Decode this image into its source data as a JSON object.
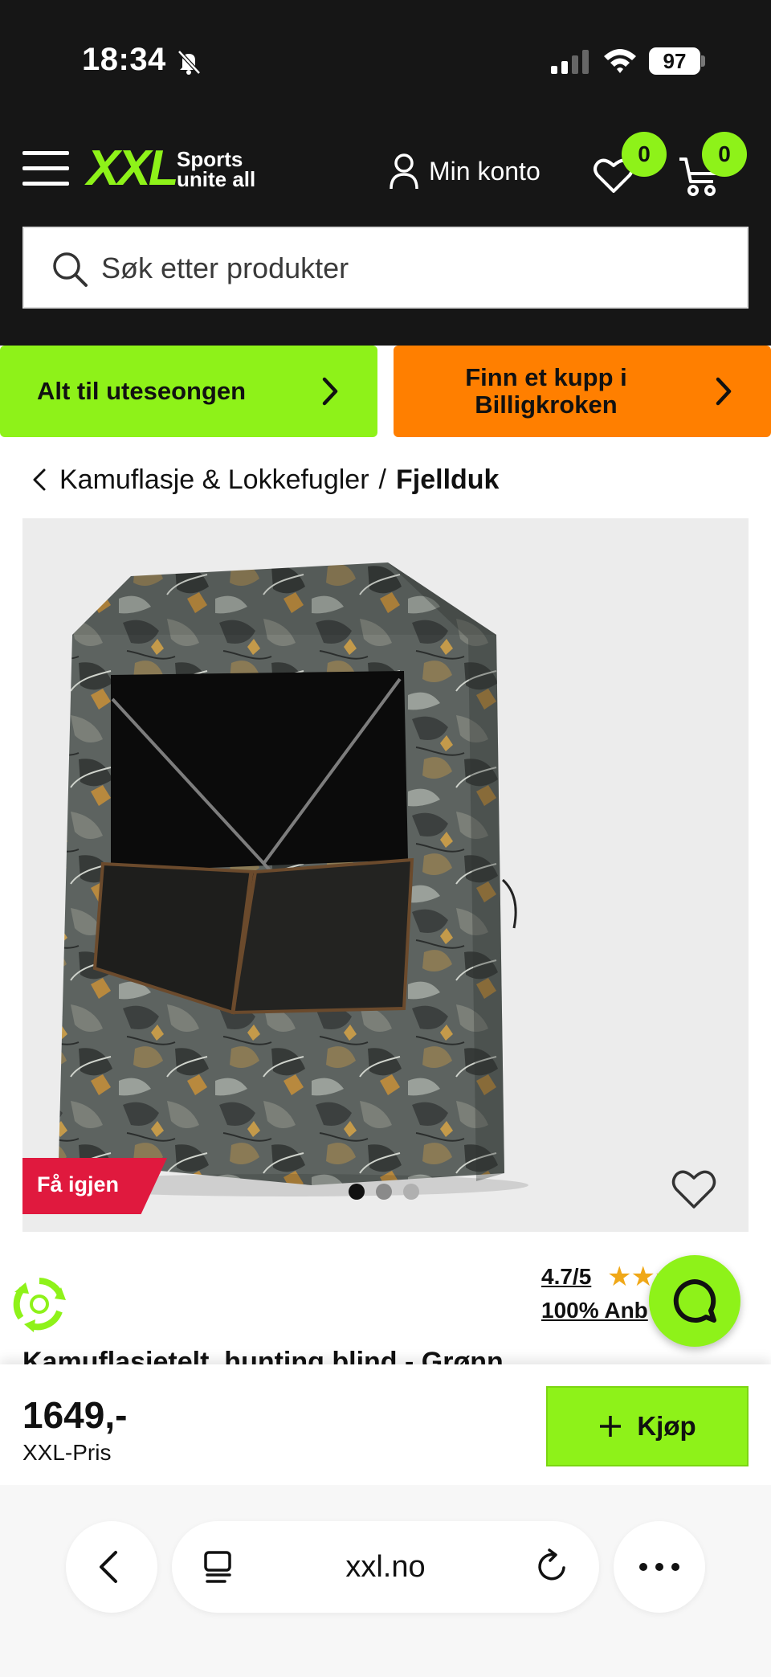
{
  "status_bar": {
    "time": "18:34",
    "battery": "97"
  },
  "header": {
    "logo_text": "XXL",
    "logo_tagline_line1": "Sports",
    "logo_tagline_line2": "unite all",
    "account_label": "Min konto",
    "wishlist_count": "0",
    "cart_count": "0",
    "accent_color": "#8ef219"
  },
  "search": {
    "placeholder": "Søk etter produkter"
  },
  "promos": {
    "left_label": "Alt til uteseongen",
    "right_label": "Finn et kupp i Billigkroken",
    "left_color": "#8ef219",
    "right_color": "#ff7f00"
  },
  "breadcrumb": {
    "parent": "Kamuflasje & Lokkefugler",
    "separator": "/",
    "current": "Fjellduk"
  },
  "product": {
    "restock_badge": "Få igjen",
    "image_dots_count": 3,
    "image_active_index": 0,
    "rating_score": "4.7/5",
    "rating_stars": 4.7,
    "rating_recommend": "100% Anb",
    "title_partial": "Kamuflasjetelt, hunting blind - Grønn",
    "price": "1649,-",
    "price_label": "XXL-Pris",
    "buy_label": "Kjøp"
  },
  "browser": {
    "url": "xxl.no"
  },
  "icons": {
    "menu": "menu-icon",
    "account": "account-icon",
    "wishlist": "heart-icon",
    "cart": "cart-icon",
    "search": "search-icon",
    "chevron": "chevron-right-icon",
    "back": "chevron-left-icon",
    "chat": "chat-icon",
    "eco": "eco-recycle-icon",
    "reader": "reader-icon",
    "reload": "reload-icon",
    "more": "more-icon"
  }
}
